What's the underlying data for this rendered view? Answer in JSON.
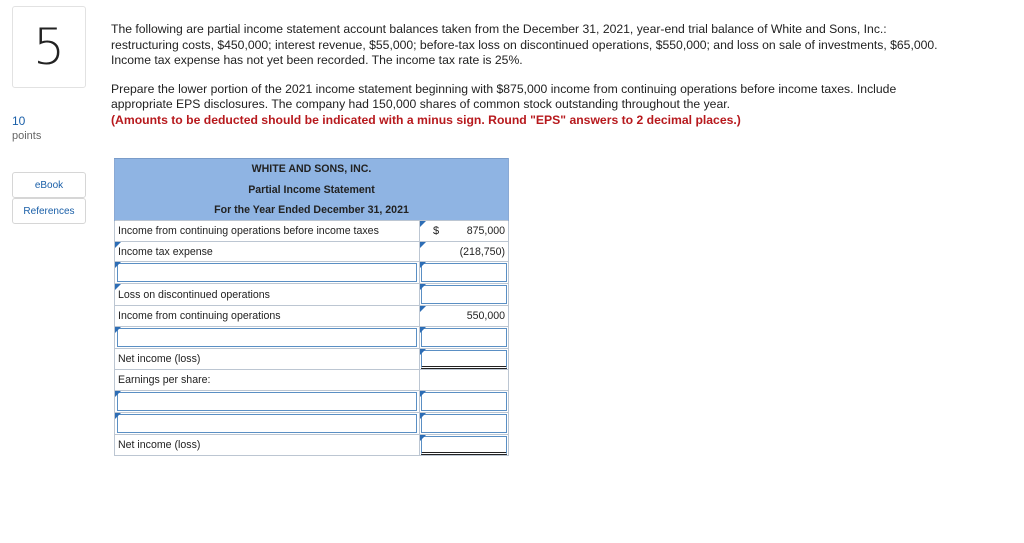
{
  "question": {
    "number": "5",
    "points_value": "10",
    "points_label": "points"
  },
  "sidebar": {
    "ebook_label": "eBook",
    "references_label": "References"
  },
  "prompt": {
    "paragraph1": "The following are partial income statement account balances taken from the December 31, 2021, year-end trial balance of White and Sons, Inc.: restructuring costs, $450,000; interest revenue, $55,000; before-tax loss on discontinued operations, $550,000; and loss on sale of investments, $65,000. Income tax expense has not yet been recorded. The income tax rate is 25%.",
    "paragraph2": "Prepare the lower portion of the 2021 income statement beginning with $875,000 income from continuing operations before income taxes. Include appropriate EPS disclosures. The company had 150,000 shares of common stock outstanding throughout the year.",
    "instruction": "(Amounts to be deducted should be indicated with a minus sign. Round \"EPS\" answers to 2 decimal places.)"
  },
  "statement": {
    "company": "WHITE AND SONS, INC.",
    "title": "Partial Income Statement",
    "period": "For the Year Ended December 31, 2021",
    "rows": [
      {
        "label": "Income from continuing operations before income taxes",
        "dollar": "$",
        "amount": "875,000"
      },
      {
        "label": "Income tax expense",
        "dollar": "",
        "amount": "(218,750)"
      },
      {
        "label": "",
        "dollar": "",
        "amount": ""
      },
      {
        "label": "Loss on discontinued operations",
        "dollar": "",
        "amount": ""
      },
      {
        "label": "Income from continuing operations",
        "dollar": "",
        "amount": "550,000"
      },
      {
        "label": "",
        "dollar": "",
        "amount": ""
      },
      {
        "label": "Net income (loss)",
        "dollar": "",
        "amount": ""
      },
      {
        "label": "Earnings per share:",
        "dollar": "",
        "amount": ""
      },
      {
        "label": "",
        "dollar": "",
        "amount": ""
      },
      {
        "label": "",
        "dollar": "",
        "amount": ""
      },
      {
        "label": "Net income (loss)",
        "dollar": "",
        "amount": ""
      }
    ]
  }
}
